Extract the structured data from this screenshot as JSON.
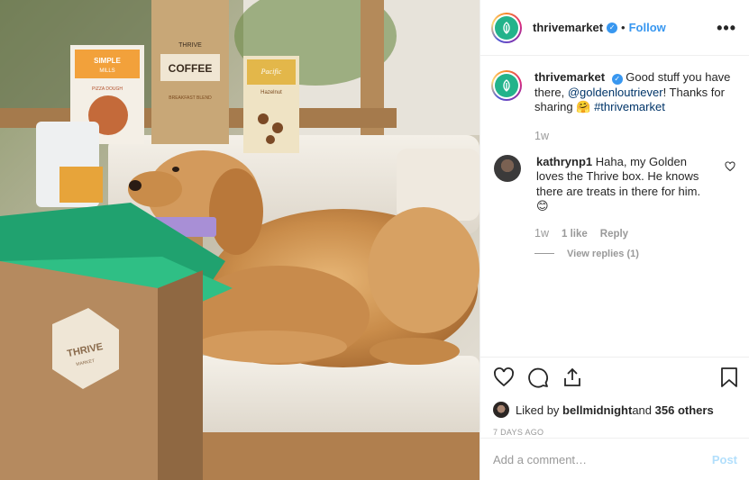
{
  "post": {
    "photo_alt": "Golden retriever resting on chair with Thrive Market box",
    "box_brand": "THRIVE",
    "box_sub": "MARKET",
    "coffee_bag_top": "THRIVE",
    "coffee_bag_label": "COFFEE",
    "coffee_bag_sub": "BREAKFAST BLEND",
    "mix_box_brand": "SIMPLE",
    "mix_box_sub": "MILLS",
    "mix_box_label": "PIZZA DOUGH",
    "broth_brand": "Pacific",
    "broth_label": "Hazelnut"
  },
  "header": {
    "username": "thrivemarket",
    "separator": "•",
    "follow_label": "Follow",
    "more_label": "•••"
  },
  "caption": {
    "username": "thrivemarket",
    "text_1": "Good stuff you have there, ",
    "mention": "@goldenloutriever",
    "text_2": "! Thanks for sharing ",
    "emoji": "🤗",
    "hashtag": "#thrivemarket",
    "time": "1w"
  },
  "comment": {
    "username": "kathrynp1",
    "text": "Haha, my Golden loves the Thrive box. He knows there are treats in there for him. 😊",
    "time": "1w",
    "likes": "1 like",
    "reply_label": "Reply",
    "view_replies": "View replies (1)"
  },
  "actions": {
    "liked_prefix": "Liked by ",
    "liked_user": "bellmidnight",
    "liked_middle": " and ",
    "liked_others": "356 others",
    "posted_time": "7 DAYS AGO"
  },
  "add_comment": {
    "placeholder": "Add a comment…",
    "post_label": "Post"
  },
  "colors": {
    "link_blue": "#3897f0",
    "brand_green": "#23b38b",
    "post_disabled": "#b2dffc"
  }
}
